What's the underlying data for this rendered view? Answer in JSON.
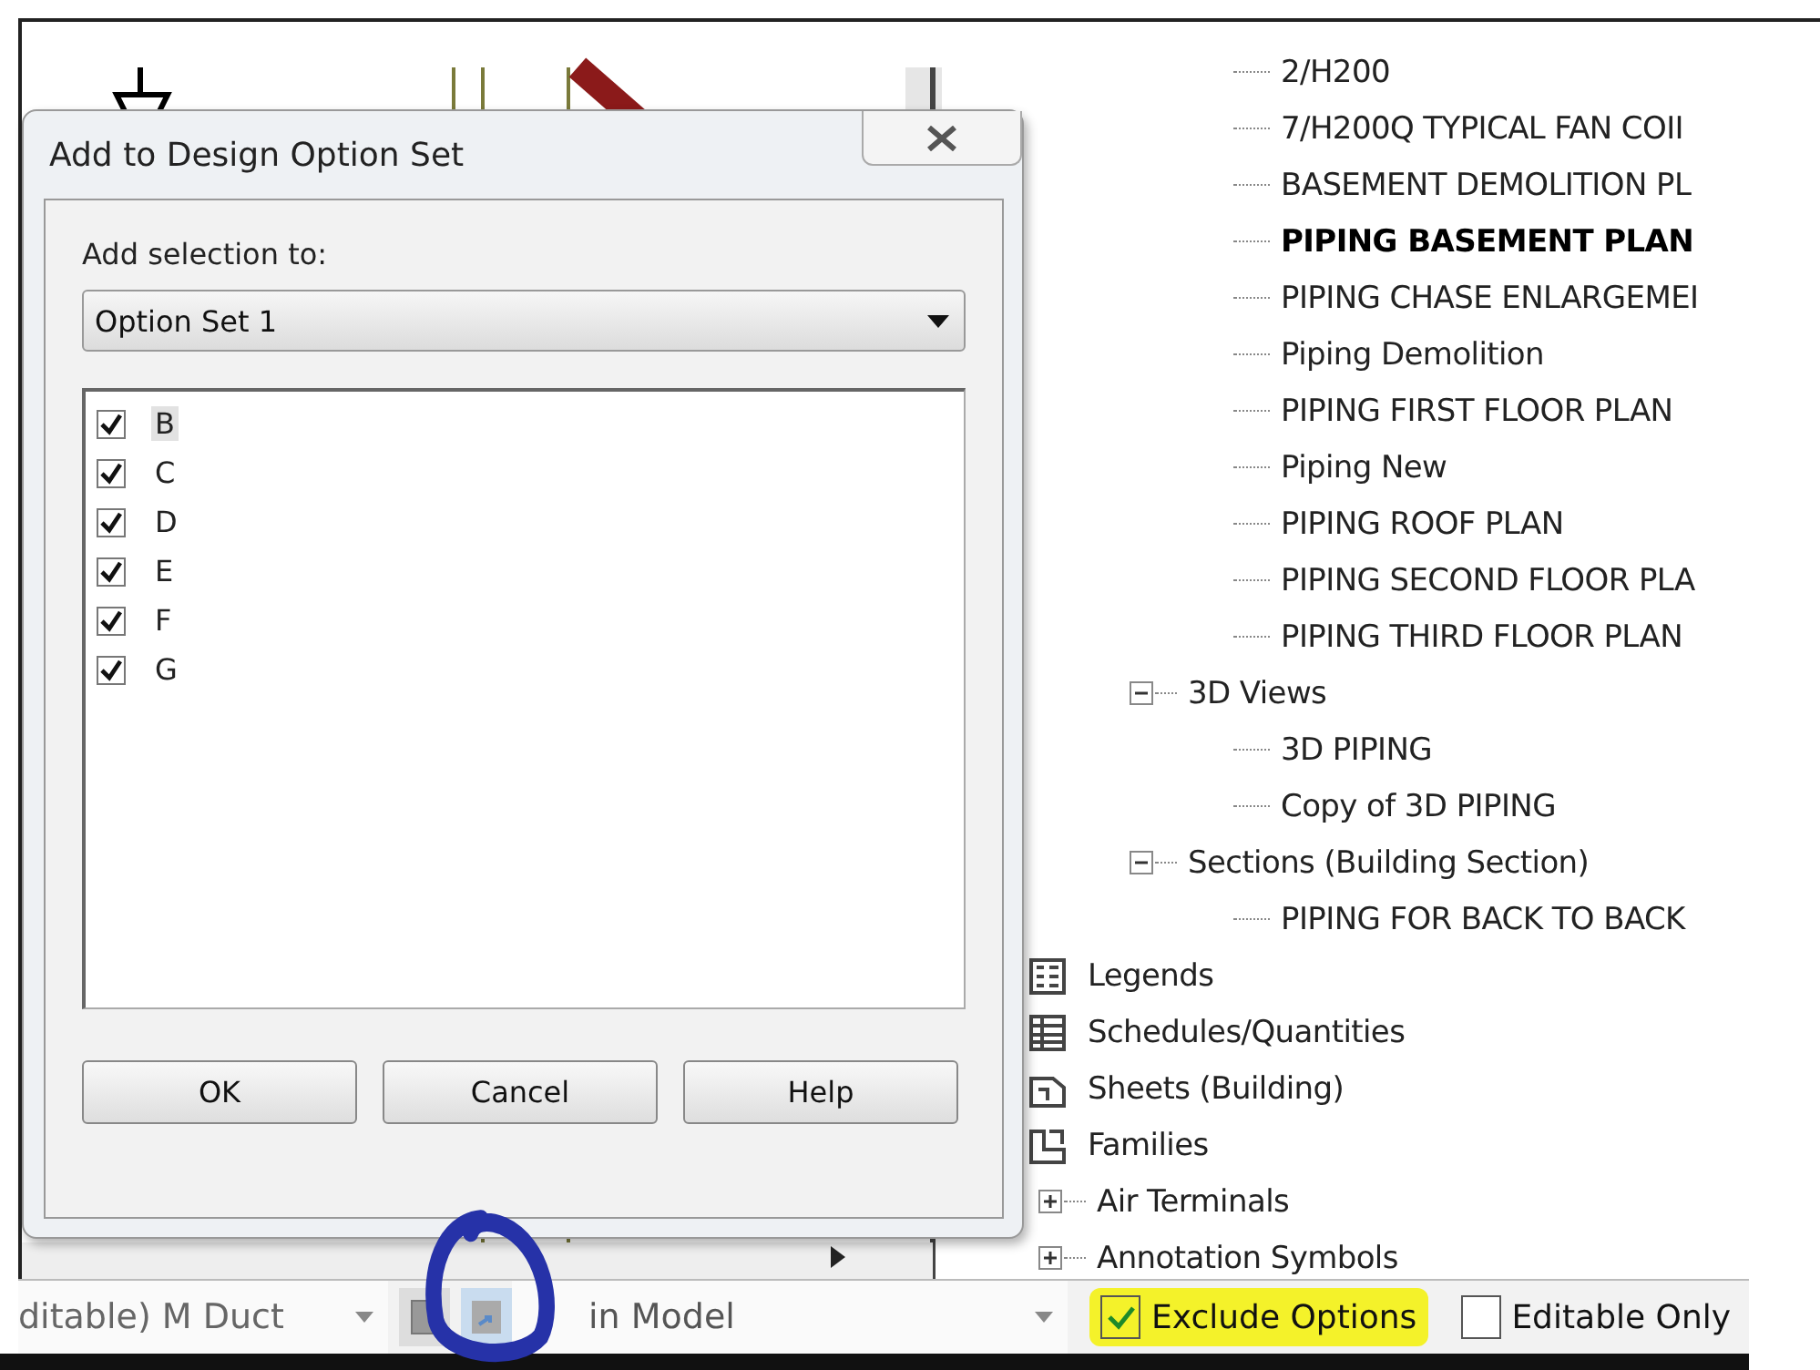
{
  "dialog": {
    "title": "Add to Design Option Set",
    "field_label": "Add selection to:",
    "option_set": {
      "value": "Option Set 1"
    },
    "items": [
      {
        "label": "B",
        "checked": true,
        "selected": true
      },
      {
        "label": "C",
        "checked": true,
        "selected": false
      },
      {
        "label": "D",
        "checked": true,
        "selected": false
      },
      {
        "label": "E",
        "checked": true,
        "selected": false
      },
      {
        "label": "F",
        "checked": true,
        "selected": false
      },
      {
        "label": "G",
        "checked": true,
        "selected": false
      }
    ],
    "buttons": [
      "OK",
      "Cancel",
      "Help"
    ]
  },
  "project_browser": {
    "views": [
      {
        "children": [
          {
            "label": "2/H200",
            "current": false
          },
          {
            "label": "7/H200Q TYPICAL FAN COII",
            "current": false
          },
          {
            "label": "BASEMENT DEMOLITION PL",
            "current": false
          },
          {
            "label": "PIPING BASEMENT PLAN",
            "current": true
          },
          {
            "label": "PIPING CHASE ENLARGEMEI",
            "current": false
          },
          {
            "label": "Piping Demolition",
            "current": false
          },
          {
            "label": "PIPING FIRST FLOOR PLAN",
            "current": false
          },
          {
            "label": "Piping New",
            "current": false
          },
          {
            "label": "PIPING ROOF PLAN",
            "current": false
          },
          {
            "label": "PIPING SECOND FLOOR PLA",
            "current": false
          },
          {
            "label": "PIPING THIRD FLOOR PLAN",
            "current": false
          }
        ]
      },
      {
        "label": "3D Views",
        "expanded": true,
        "children": [
          {
            "label": "3D PIPING",
            "current": false
          },
          {
            "label": "Copy of 3D PIPING",
            "current": false
          }
        ]
      },
      {
        "label": "Sections (Building Section)",
        "expanded": true,
        "children": [
          {
            "label": "PIPING FOR BACK TO BACK",
            "current": false
          }
        ]
      }
    ],
    "categories": [
      {
        "label": "Legends",
        "kind": "legends"
      },
      {
        "label": "Schedules/Quantities",
        "kind": "schedules"
      },
      {
        "label": "Sheets (Building)",
        "kind": "sheets"
      },
      {
        "label": "Families",
        "kind": "families",
        "children": [
          {
            "label": "Air Terminals",
            "expanded": false
          },
          {
            "label": "Annotation Symbols",
            "expanded": false
          }
        ]
      }
    ]
  },
  "status_bar": {
    "type_selector": {
      "value": "ditable) M Duct"
    },
    "workset": {
      "value": "in Model"
    },
    "options": [
      {
        "label": "Exclude Options",
        "checked": true,
        "highlighted": true
      },
      {
        "label": "Editable Only",
        "checked": false,
        "highlighted": false
      }
    ]
  }
}
